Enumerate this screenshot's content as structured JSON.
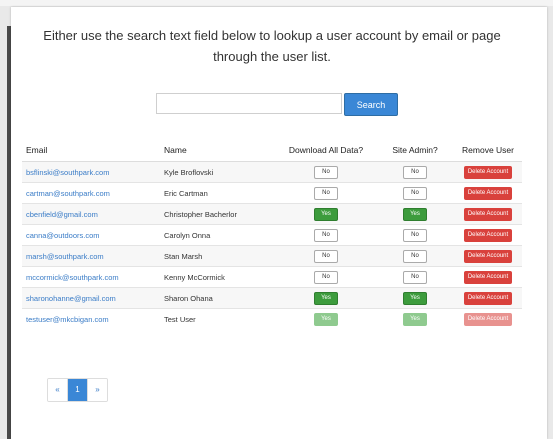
{
  "instructions": "Either use the search text field below to lookup a user account by email or page through the user list.",
  "search": {
    "placeholder": "",
    "button_label": "Search"
  },
  "table": {
    "headers": {
      "email": "Email",
      "name": "Name",
      "download": "Download All Data?",
      "admin": "Site Admin?",
      "remove": "Remove User"
    },
    "rows": [
      {
        "email": "bsflinski@southpark.com",
        "name": "Kyle Broflovski",
        "download": "No",
        "admin": "No",
        "remove": "Delete Account",
        "disabled": false
      },
      {
        "email": "cartman@southpark.com",
        "name": "Eric Cartman",
        "download": "No",
        "admin": "No",
        "remove": "Delete Account",
        "disabled": false
      },
      {
        "email": "cbenfield@gmail.com",
        "name": "Christopher Bacherlor",
        "download": "Yes",
        "admin": "Yes",
        "remove": "Delete Account",
        "disabled": false
      },
      {
        "email": "canna@outdoors.com",
        "name": "Carolyn Onna",
        "download": "No",
        "admin": "No",
        "remove": "Delete Account",
        "disabled": false
      },
      {
        "email": "marsh@southpark.com",
        "name": "Stan Marsh",
        "download": "No",
        "admin": "No",
        "remove": "Delete Account",
        "disabled": false
      },
      {
        "email": "mccormick@southpark.com",
        "name": "Kenny McCormick",
        "download": "No",
        "admin": "No",
        "remove": "Delete Account",
        "disabled": false
      },
      {
        "email": "sharonohanne@gmail.com",
        "name": "Sharon Ohana",
        "download": "Yes",
        "admin": "Yes",
        "remove": "Delete Account",
        "disabled": false
      },
      {
        "email": "testuser@mkcbigan.com",
        "name": "Test User",
        "download": "Yes",
        "admin": "Yes",
        "remove": "Delete Account",
        "disabled": true
      }
    ]
  },
  "pagination": {
    "prev": "«",
    "current": "1",
    "next": "»"
  }
}
